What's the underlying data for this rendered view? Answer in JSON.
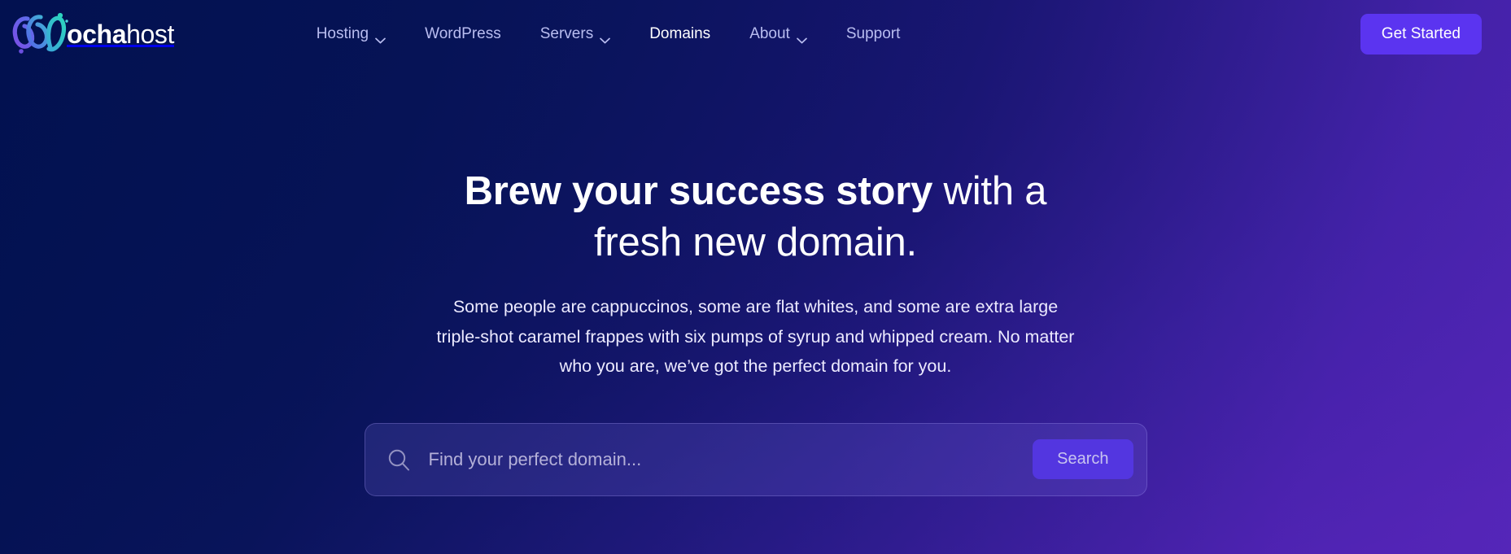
{
  "brand": {
    "logo_icon": "mochahost-loop-logo-icon",
    "name_bold": "ocha",
    "name_light": "host",
    "colors": {
      "logo_purple": "#6B4FE0",
      "logo_blue": "#4F6FE8",
      "logo_teal": "#2DD4BF",
      "accent_button": "#5B34F0",
      "search_button": "#5336E0",
      "bg_dark_navy": "#021150",
      "bg_purple": "#4A1FA0"
    }
  },
  "nav": {
    "items": [
      {
        "label": "Hosting",
        "has_dropdown": true,
        "active": false,
        "icon": "chevron-down-icon"
      },
      {
        "label": "WordPress",
        "has_dropdown": false,
        "active": false,
        "icon": ""
      },
      {
        "label": "Servers",
        "has_dropdown": true,
        "active": false,
        "icon": "chevron-down-icon"
      },
      {
        "label": "Domains",
        "has_dropdown": false,
        "active": true,
        "icon": ""
      },
      {
        "label": "About",
        "has_dropdown": true,
        "active": false,
        "icon": "chevron-down-icon"
      },
      {
        "label": "Support",
        "has_dropdown": false,
        "active": false,
        "icon": ""
      }
    ],
    "cta_label": "Get Started"
  },
  "hero": {
    "title_strong": "Brew your success story",
    "title_rest": " with a fresh new domain.",
    "subtitle": "Some people are cappuccinos, some are flat whites, and some are extra large triple-shot caramel frappes with six pumps of syrup and whipped cream. No matter who you are, we’ve got the perfect domain for you."
  },
  "search": {
    "icon": "search-icon",
    "value": "",
    "placeholder": "Find your perfect domain...",
    "button_label": "Search"
  }
}
